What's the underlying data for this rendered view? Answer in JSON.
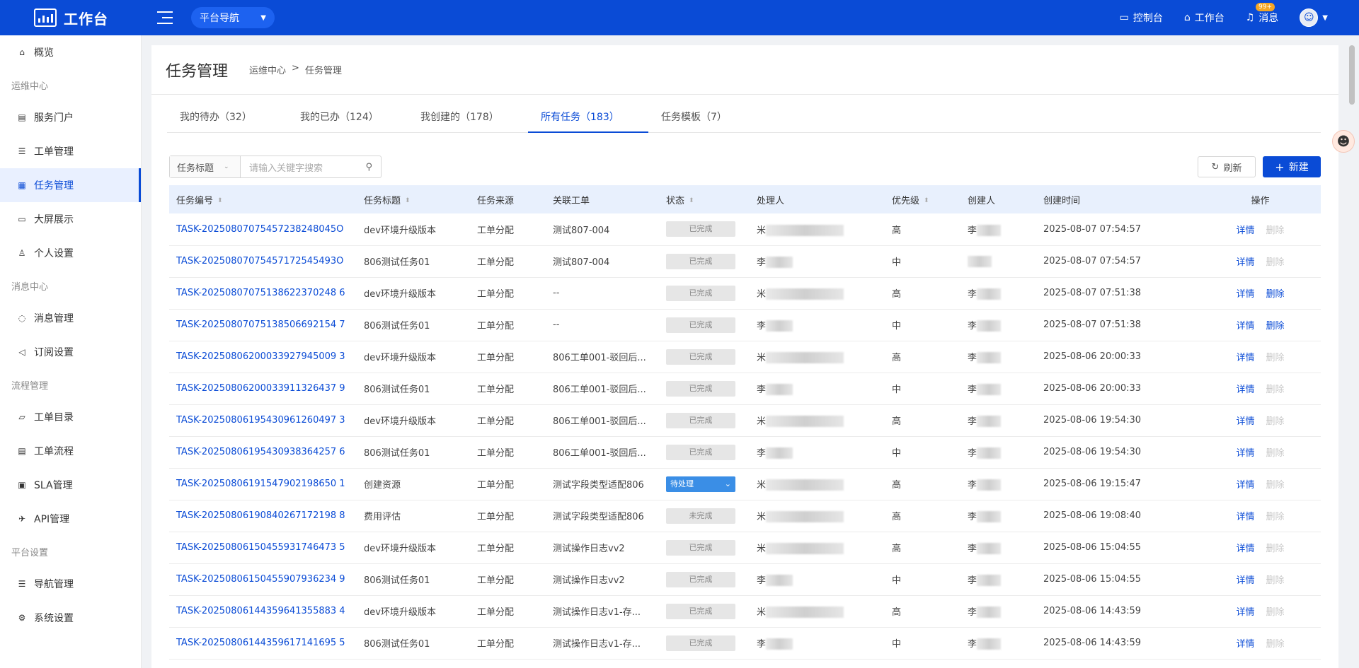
{
  "topbar": {
    "title": "工作台",
    "platnav": "平台导航",
    "console": "控制台",
    "workbench": "工作台",
    "messages": "消息",
    "badge": "99+"
  },
  "sidebar": {
    "items": [
      {
        "type": "item",
        "label": "概览",
        "icon": "home-icon",
        "glyph": "⌂"
      },
      {
        "type": "group",
        "label": "运维中心"
      },
      {
        "type": "item",
        "label": "服务门户",
        "icon": "portal-icon",
        "glyph": "▤"
      },
      {
        "type": "item",
        "label": "工单管理",
        "icon": "list-icon",
        "glyph": "☰"
      },
      {
        "type": "item",
        "label": "任务管理",
        "icon": "calendar-icon",
        "glyph": "▦",
        "active": true
      },
      {
        "type": "item",
        "label": "大屏展示",
        "icon": "monitor-icon",
        "glyph": "▭"
      },
      {
        "type": "item",
        "label": "个人设置",
        "icon": "user-icon",
        "glyph": "♙"
      },
      {
        "type": "group",
        "label": "消息中心"
      },
      {
        "type": "item",
        "label": "消息管理",
        "icon": "chat-icon",
        "glyph": "◌"
      },
      {
        "type": "item",
        "label": "订阅设置",
        "icon": "speaker-icon",
        "glyph": "◁"
      },
      {
        "type": "group",
        "label": "流程管理"
      },
      {
        "type": "item",
        "label": "工单目录",
        "icon": "folder-icon",
        "glyph": "▱"
      },
      {
        "type": "item",
        "label": "工单流程",
        "icon": "doc-icon",
        "glyph": "▤"
      },
      {
        "type": "item",
        "label": "SLA管理",
        "icon": "sla-icon",
        "glyph": "▣"
      },
      {
        "type": "item",
        "label": "API管理",
        "icon": "rocket-icon",
        "glyph": "✈"
      },
      {
        "type": "group",
        "label": "平台设置"
      },
      {
        "type": "item",
        "label": "导航管理",
        "icon": "list-icon",
        "glyph": "☰"
      },
      {
        "type": "item",
        "label": "系统设置",
        "icon": "gear-icon",
        "glyph": "⚙"
      }
    ]
  },
  "page": {
    "title": "任务管理",
    "breadcrumb": [
      "运维中心",
      ">",
      "任务管理"
    ]
  },
  "tabs": [
    {
      "label": "我的待办（32）"
    },
    {
      "label": "我的已办（124）"
    },
    {
      "label": "我创建的（178）"
    },
    {
      "label": "所有任务（183）",
      "active": true
    },
    {
      "label": "任务模板（7）"
    }
  ],
  "filter": {
    "field": "任务标题",
    "placeholder": "请输入关键字搜索"
  },
  "buttons": {
    "refresh": "刷新",
    "new": "新建"
  },
  "table": {
    "columns": [
      "任务编号",
      "任务标题",
      "任务来源",
      "关联工单",
      "状态",
      "处理人",
      "优先级",
      "创建人",
      "创建时间",
      "操作"
    ],
    "rows": [
      {
        "id": "TASK-20250807075457238248045O",
        "title": "dev环境升级版本",
        "source": "工单分配",
        "ticket": "测试807-004",
        "status": "已完成",
        "handler": "米",
        "priority": "高",
        "creator": "李",
        "time": "2025-08-07 07:54:57",
        "detail": "详情",
        "delete": "删除",
        "del_enabled": false
      },
      {
        "id": "TASK-20250807075457172545493O",
        "title": "806测试任务01",
        "source": "工单分配",
        "ticket": "测试807-004",
        "status": "已完成",
        "handler": "李",
        "priority": "中",
        "creator": "",
        "time": "2025-08-07 07:54:57",
        "detail": "详情",
        "delete": "删除",
        "del_enabled": false
      },
      {
        "id": "TASK-20250807075138622370248 6",
        "title": "dev环境升级版本",
        "source": "工单分配",
        "ticket": "--",
        "status": "已完成",
        "handler": "米",
        "priority": "高",
        "creator": "李",
        "time": "2025-08-07 07:51:38",
        "detail": "详情",
        "delete": "删除",
        "del_enabled": true
      },
      {
        "id": "TASK-20250807075138506692154 7",
        "title": "806测试任务01",
        "source": "工单分配",
        "ticket": "--",
        "status": "已完成",
        "handler": "李",
        "priority": "中",
        "creator": "李",
        "time": "2025-08-07 07:51:38",
        "detail": "详情",
        "delete": "删除",
        "del_enabled": true
      },
      {
        "id": "TASK-20250806200033927945009 3",
        "title": "dev环境升级版本",
        "source": "工单分配",
        "ticket": "806工单001-驳回后...",
        "status": "已完成",
        "handler": "米",
        "priority": "高",
        "creator": "李",
        "time": "2025-08-06 20:00:33",
        "detail": "详情",
        "delete": "删除",
        "del_enabled": false
      },
      {
        "id": "TASK-20250806200033911326437 9",
        "title": "806测试任务01",
        "source": "工单分配",
        "ticket": "806工单001-驳回后...",
        "status": "已完成",
        "handler": "李",
        "priority": "中",
        "creator": "李",
        "time": "2025-08-06 20:00:33",
        "detail": "详情",
        "delete": "删除",
        "del_enabled": false
      },
      {
        "id": "TASK-20250806195430961260497 3",
        "title": "dev环境升级版本",
        "source": "工单分配",
        "ticket": "806工单001-驳回后...",
        "status": "已完成",
        "handler": "米",
        "priority": "高",
        "creator": "李",
        "time": "2025-08-06 19:54:30",
        "detail": "详情",
        "delete": "删除",
        "del_enabled": false
      },
      {
        "id": "TASK-20250806195430938364257 6",
        "title": "806测试任务01",
        "source": "工单分配",
        "ticket": "806工单001-驳回后...",
        "status": "已完成",
        "handler": "李",
        "priority": "中",
        "creator": "李",
        "time": "2025-08-06 19:54:30",
        "detail": "详情",
        "delete": "删除",
        "del_enabled": false
      },
      {
        "id": "TASK-20250806191547902198650 1",
        "title": "创建资源",
        "source": "工单分配",
        "ticket": "测试字段类型适配806",
        "status": "待处理",
        "handler": "米",
        "priority": "高",
        "creator": "李",
        "time": "2025-08-06 19:15:47",
        "detail": "详情",
        "delete": "删除",
        "del_enabled": false
      },
      {
        "id": "TASK-20250806190840267172198 8",
        "title": "费用评估",
        "source": "工单分配",
        "ticket": "测试字段类型适配806",
        "status": "未完成",
        "handler": "米",
        "priority": "高",
        "creator": "李",
        "time": "2025-08-06 19:08:40",
        "detail": "详情",
        "delete": "删除",
        "del_enabled": false
      },
      {
        "id": "TASK-20250806150455931746473 5",
        "title": "dev环境升级版本",
        "source": "工单分配",
        "ticket": "测试操作日志vv2",
        "status": "已完成",
        "handler": "米",
        "priority": "高",
        "creator": "李",
        "time": "2025-08-06 15:04:55",
        "detail": "详情",
        "delete": "删除",
        "del_enabled": false
      },
      {
        "id": "TASK-20250806150455907936234 9",
        "title": "806测试任务01",
        "source": "工单分配",
        "ticket": "测试操作日志vv2",
        "status": "已完成",
        "handler": "李",
        "priority": "中",
        "creator": "李",
        "time": "2025-08-06 15:04:55",
        "detail": "详情",
        "delete": "删除",
        "del_enabled": false
      },
      {
        "id": "TASK-20250806144359641355883 4",
        "title": "dev环境升级版本",
        "source": "工单分配",
        "ticket": "测试操作日志v1-存...",
        "status": "已完成",
        "handler": "米",
        "priority": "高",
        "creator": "李",
        "time": "2025-08-06 14:43:59",
        "detail": "详情",
        "delete": "删除",
        "del_enabled": false
      },
      {
        "id": "TASK-20250806144359617141695 5",
        "title": "806测试任务01",
        "source": "工单分配",
        "ticket": "测试操作日志v1-存...",
        "status": "已完成",
        "handler": "李",
        "priority": "中",
        "creator": "李",
        "time": "2025-08-06 14:43:59",
        "detail": "详情",
        "delete": "删除",
        "del_enabled": false
      }
    ]
  }
}
